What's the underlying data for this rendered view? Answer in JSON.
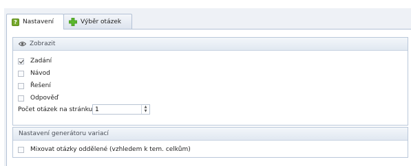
{
  "tabs": [
    {
      "label": "Nastavení",
      "icon": "question-icon"
    },
    {
      "label": "Výběr otázek",
      "icon": "green-plus-icon"
    }
  ],
  "display_group": {
    "title": "Zobrazit",
    "icon": "eye-icon",
    "checkboxes": [
      {
        "label": "Zadání",
        "checked": true
      },
      {
        "label": "Návod",
        "checked": false
      },
      {
        "label": "Řešení",
        "checked": false
      },
      {
        "label": "Odpověď",
        "checked": false
      }
    ],
    "per_page_label": "Počet otázek na stránku",
    "per_page_value": "1"
  },
  "generator_group": {
    "title": "Nastavení generátoru variací",
    "mix_label": "Mixovat otázky oddělené (vzhledem k tem. celkům)",
    "mix_checked": false
  },
  "colors": {
    "accent_green": "#76a92c",
    "border": "#b9c7da"
  }
}
